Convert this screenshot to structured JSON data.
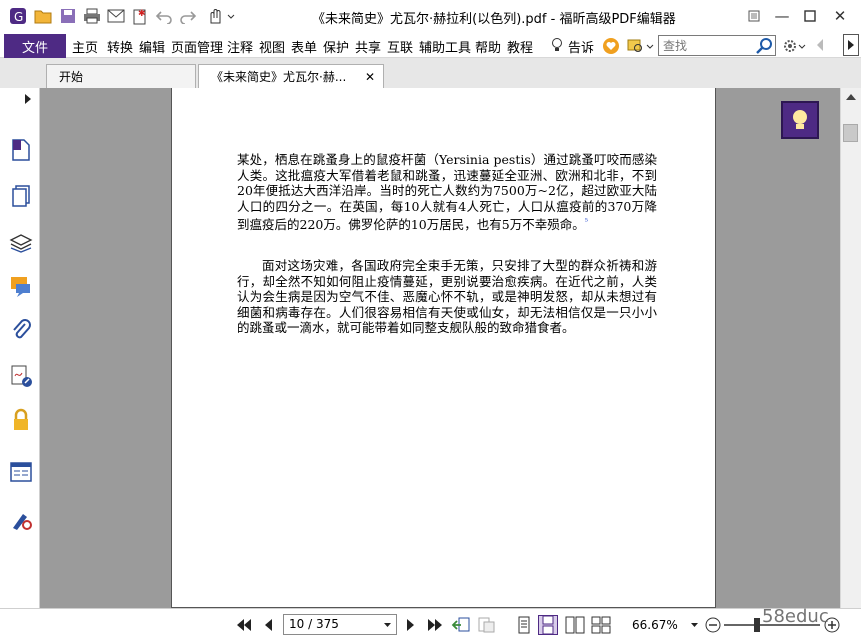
{
  "titlebar": {
    "title": "《未来简史》尤瓦尔·赫拉利(以色列).pdf - 福昕高级PDF编辑器",
    "buttons": [
      "app-logo-icon",
      "open-folder-icon",
      "save-icon",
      "print-icon",
      "email-icon",
      "new-icon",
      "undo-icon",
      "redo-icon",
      "hand-tool-icon"
    ]
  },
  "menubar": {
    "file_label": "文件",
    "items": [
      "主页",
      "转换",
      "编辑",
      "页面管理",
      "注释",
      "视图",
      "表单",
      "保护",
      "共享",
      "互联",
      "辅助工具",
      "帮助",
      "教程"
    ],
    "tellme_label": "告诉",
    "search_placeholder": "查找"
  },
  "tabs": [
    {
      "label": "开始"
    },
    {
      "label": "《未来简史》尤瓦尔·赫...",
      "close": "✕"
    }
  ],
  "document": {
    "paragraph1": "某处，栖息在跳蚤身上的鼠疫杆菌（Yersinia pestis）通过跳蚤叮咬而感染人类。这批瘟疫大军借着老鼠和跳蚤，迅速蔓延全亚洲、欧洲和北非，不到20年便抵达大西洋沿岸。当时的死亡人数约为7500万~2亿，超过欧亚大陆人口的四分之一。在英国，每10人就有4人死亡，人口从瘟疫前的370万降到瘟疫后的220万。佛罗伦萨的10万居民，也有5万不幸殒命。",
    "footnote_mark": "⁵",
    "paragraph2": "面对这场灾难，各国政府完全束手无策，只安排了大型的群众祈祷和游行，却全然不知如何阻止疫情蔓延，更别说要治愈疾病。在近代之前，人类认为会生病是因为空气不佳、恶魔心怀不轨，或是神明发怒，却从未想过有细菌和病毒存在。人们很容易相信有天使或仙女，却无法相信仅是一只小小的跳蚤或一滴水，就可能带着如同整支舰队般的致命猎食者。"
  },
  "statusbar": {
    "page_display": "10 / 375",
    "zoom": "66.67%"
  },
  "watermark": "58educ",
  "colors": {
    "accent": "#4e2a84",
    "doc_bg": "#9b9b9b"
  }
}
